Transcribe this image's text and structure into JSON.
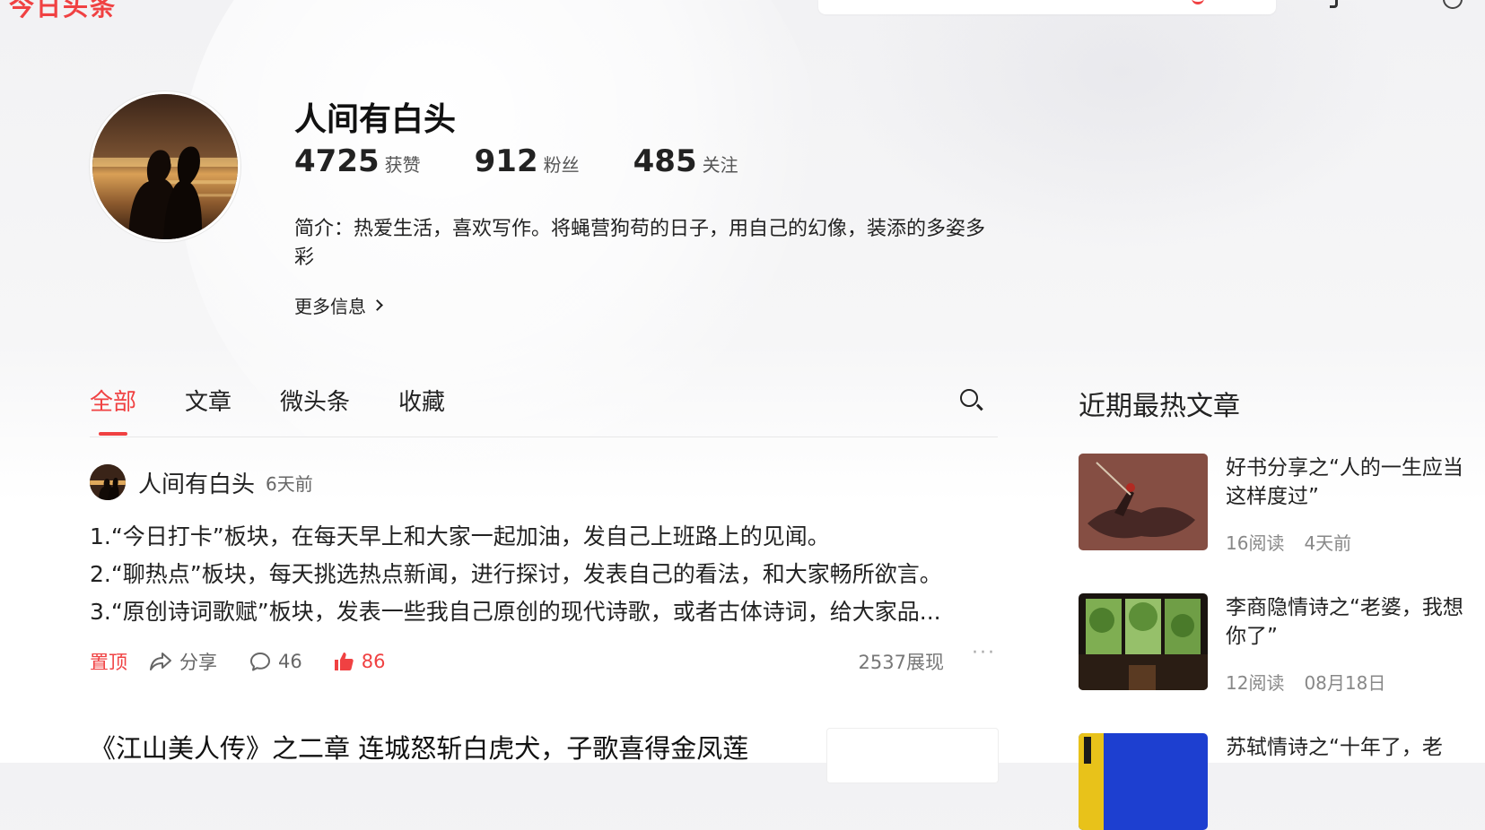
{
  "header": {
    "logo_text": "今日头条",
    "brand_color": "#f04142"
  },
  "profile": {
    "name": "人间有白头",
    "stats": [
      {
        "num": "4725",
        "label": "获赞"
      },
      {
        "num": "912",
        "label": "粉丝"
      },
      {
        "num": "485",
        "label": "关注"
      }
    ],
    "bio": "简介：热爱生活，喜欢写作。将蝇营狗苟的日子，用自己的幻像，装添的多姿多彩",
    "more_info": "更多信息"
  },
  "tabs": [
    {
      "label": "全部",
      "active": true
    },
    {
      "label": "文章",
      "active": false
    },
    {
      "label": "微头条",
      "active": false
    },
    {
      "label": "收藏",
      "active": false
    }
  ],
  "post": {
    "author": "人间有白头",
    "time": "6天前",
    "lines": [
      "1.“今日打卡”板块，在每天早上和大家一起加油，发自己上班路上的见闻。",
      "2.“聊热点”板块，每天挑选热点新闻，进行探讨，发表自己的看法，和大家畅所欲言。",
      "3.“原创诗词歌赋”板块，发表一些我自己原创的现代诗歌，或者古体诗词，给大家品..."
    ],
    "pin_label": "置顶",
    "share_label": "分享",
    "comment_count": "46",
    "like_count": "86",
    "views": "2537展现",
    "more": "···"
  },
  "post2": {
    "title": "《江山美人传》之二章 连城怒斩白虎犬，子歌喜得金凤莲"
  },
  "sidebar": {
    "title": "近期最热文章",
    "items": [
      {
        "title": "好书分享之“人的一生应当这样度过”",
        "reads": "16阅读",
        "time": "4天前"
      },
      {
        "title": "李商隐情诗之“老婆，我想你了”",
        "reads": "12阅读",
        "time": "08月18日"
      },
      {
        "title": "苏轼情诗之“十年了，老",
        "reads": "",
        "time": ""
      }
    ]
  }
}
